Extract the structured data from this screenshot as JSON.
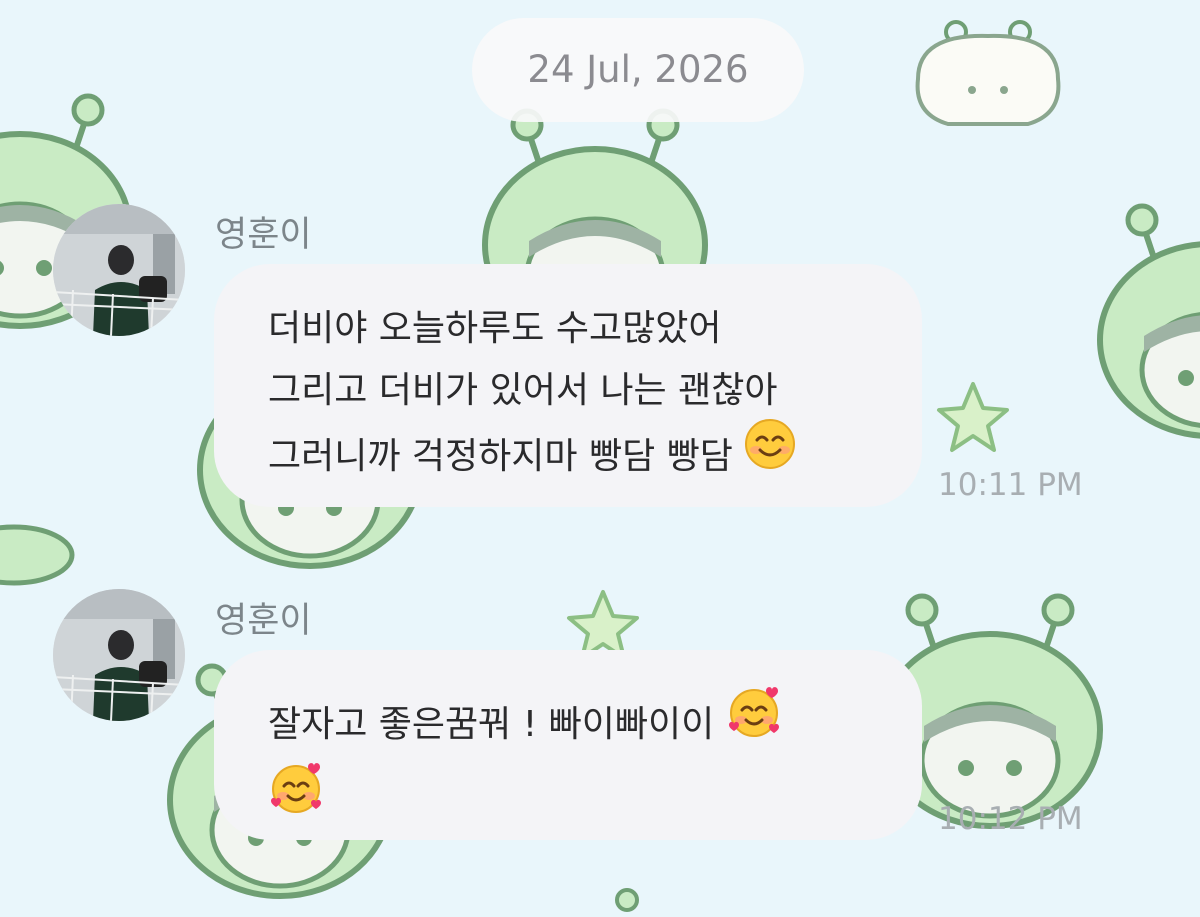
{
  "chat": {
    "date_separator": "24 Jul, 2026",
    "messages": [
      {
        "sender": "영훈이",
        "lines": [
          "더비야 오늘하루도 수고많았어",
          "그리고 더비가 있어서 나는 괜찮아",
          "그러니까 걱정하지마 빵담 빵담"
        ],
        "emoji": "smiling-face-icon",
        "time": "10:11 PM"
      },
      {
        "sender": "영훈이",
        "lines": [
          "잘자고 좋은꿈꿔 ! 빠이빠이이"
        ],
        "emoji": "smiling-face-with-hearts-icon",
        "time": "10:12 PM"
      }
    ]
  },
  "colors": {
    "background": "#e9f6fb",
    "bubble": "#f4f4f7",
    "text": "#2a2a2c",
    "sender_name": "#7c858a",
    "timestamp": "#a8aeb2",
    "wallpaper_character": "#c9ebc4"
  }
}
